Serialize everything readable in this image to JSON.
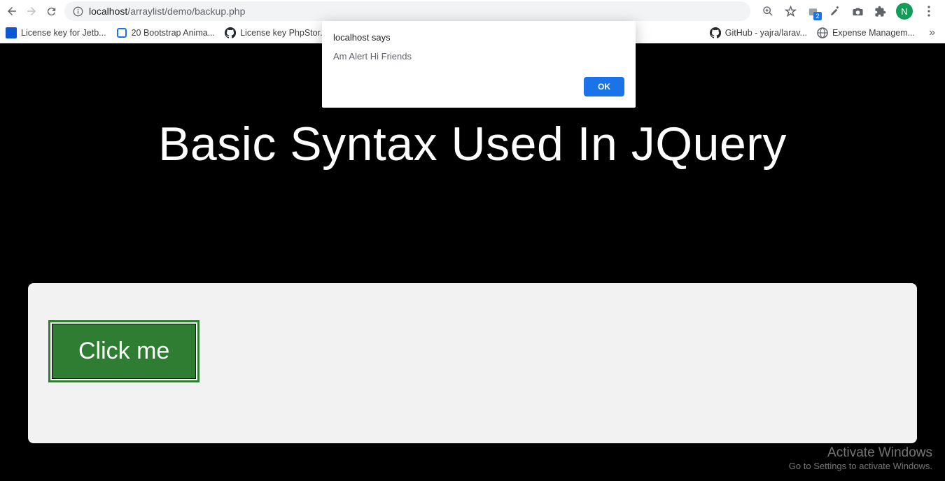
{
  "browser": {
    "url_host": "localhost",
    "url_path": "/arraylist/demo/backup.php",
    "ext_badge": "2",
    "avatar_letter": "N"
  },
  "bookmarks": [
    {
      "label": "License key for Jetb...",
      "icon": "generic-blue"
    },
    {
      "label": "20 Bootstrap Anima...",
      "icon": "doc-blue"
    },
    {
      "label": "License key PhpStor...",
      "icon": "github"
    },
    {
      "label": "GitHub - yajra/larav...",
      "icon": "github"
    },
    {
      "label": "Expense Managem...",
      "icon": "globe"
    }
  ],
  "alert": {
    "title": "localhost says",
    "message": "Am Alert Hi Friends",
    "ok": "OK"
  },
  "page": {
    "heading": "Basic Syntax Used In JQuery",
    "button": "Click me"
  },
  "watermark": {
    "title": "Activate Windows",
    "sub": "Go to Settings to activate Windows."
  }
}
